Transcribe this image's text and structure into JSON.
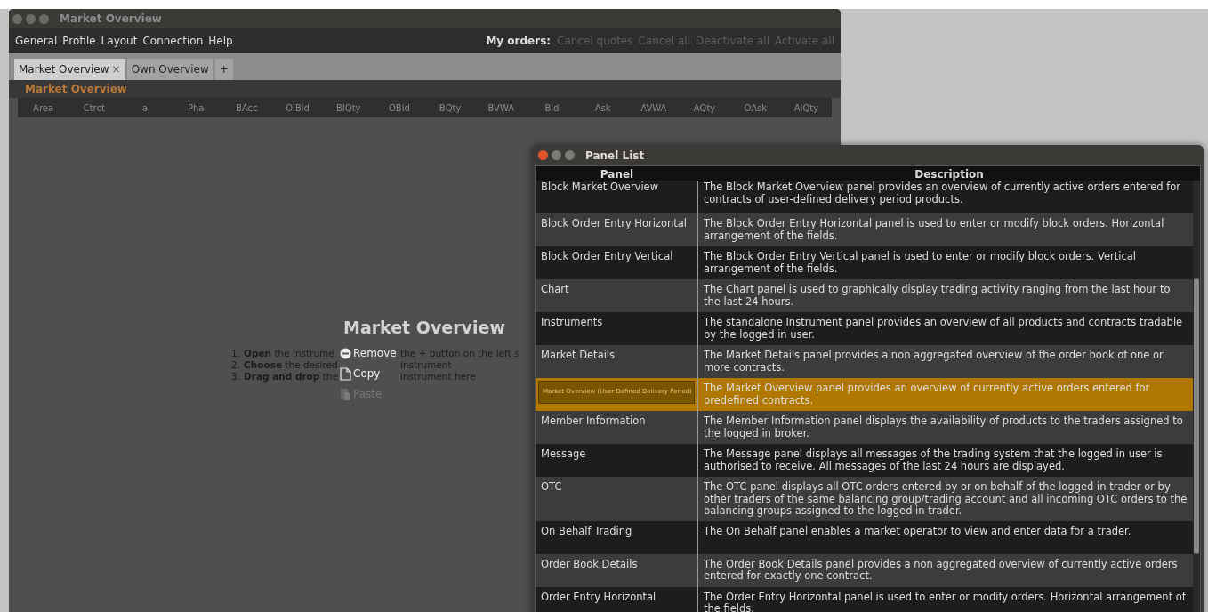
{
  "main_window": {
    "title": "Market Overview",
    "menu": [
      "General",
      "Profile",
      "Layout",
      "Connection",
      "Help"
    ],
    "my_orders": {
      "label": "My orders:",
      "actions": [
        {
          "label": "Cancel quotes",
          "disabled": true
        },
        {
          "label": "Cancel all",
          "disabled": true
        },
        {
          "label": "Deactivate all",
          "disabled": true
        },
        {
          "label": "Activate all",
          "disabled": true
        }
      ]
    },
    "tabs": [
      {
        "label": "Market Overview",
        "selected": true,
        "close": "×"
      },
      {
        "label": "Own Overview",
        "selected": false
      }
    ],
    "add_tab": "+",
    "panel_title": "Market Overview",
    "columns": [
      "Area",
      "Ctrct",
      "a",
      "Pha",
      "BAcc",
      "OIBid",
      "BIQty",
      "OBid",
      "BQty",
      "BVWA",
      "Bid",
      "Ask",
      "AVWA",
      "AQty",
      "OAsk",
      "AIQty"
    ],
    "empty_state": {
      "heading": "Market Overview",
      "steps": [
        {
          "number": "1.",
          "text": "**Open** the instrume",
          "tail": "the + button on the left s"
        },
        {
          "number": "2.",
          "text": "**Choose** the desired",
          "tail": "instrument"
        },
        {
          "number": "3.",
          "text": "**Drag and drop** the",
          "tail": "instrument here"
        }
      ]
    }
  },
  "context_menu": [
    {
      "kind": "remove",
      "label": "Remove",
      "disabled": false
    },
    {
      "kind": "copy",
      "label": "Copy",
      "disabled": false
    },
    {
      "kind": "paste",
      "label": "Paste",
      "disabled": true
    }
  ],
  "panel_list": {
    "title": "Panel List",
    "columns": [
      "Panel",
      "Description"
    ],
    "rows": [
      {
        "panel": "Block Market Overview",
        "description": "The Block Market Overview panel provides an overview of currently active orders entered for contracts of user-defined delivery period products.",
        "selected": false
      },
      {
        "panel": "Block Order Entry Horizontal",
        "description": "The Block Order Entry Horizontal panel is used to enter or modify block orders. Horizontal arrangement of the fields.",
        "selected": false
      },
      {
        "panel": "Block Order Entry Vertical",
        "description": "The Block Order Entry Vertical panel is used to enter or modify block orders. Vertical arrangement of the fields.",
        "selected": false
      },
      {
        "panel": "Chart",
        "description": "The Chart panel is used to graphically display trading activity ranging from the last hour to the last 24 hours.",
        "selected": false
      },
      {
        "panel": "Instruments",
        "description": "The standalone Instrument panel provides an overview of all products and contracts tradable by the logged in user.",
        "selected": false
      },
      {
        "panel": "Market Details",
        "description": "The Market Details panel provides a non aggregated overview of the order book of one or more contracts.",
        "selected": false
      },
      {
        "panel": "Market Overview (User Defined Delivery Period)",
        "description": "The Market Overview panel provides an overview of currently active orders entered for predefined contracts.",
        "selected": true
      },
      {
        "panel": "Member Information",
        "description": "The Member Information panel displays the availability of products to the traders assigned to the logged in broker.",
        "selected": false
      },
      {
        "panel": "Message",
        "description": "The Message panel displays all messages of the trading system that the logged in user is authorised to receive. All messages of the last 24 hours are displayed.",
        "selected": false
      },
      {
        "panel": "OTC",
        "description": "The OTC panel displays all OTC orders entered by or on behalf of the logged in trader or by other traders of the same balancing group/trading account and all incoming OTC orders to the balancing groups assigned to the logged in trader.",
        "selected": false
      },
      {
        "panel": "On Behalf Trading",
        "description": "The On Behalf panel enables a market operator to view and enter data for a trader.",
        "selected": false
      },
      {
        "panel": "Order Book Details",
        "description": "The Order Book Details panel provides a non aggregated overview of currently active orders entered for exactly one contract.",
        "selected": false
      },
      {
        "panel": "Order Entry Horizontal",
        "description": "The Order Entry Horizontal panel is used to enter or modify orders. Horizontal arrangement of the fields.",
        "selected": false
      }
    ]
  }
}
